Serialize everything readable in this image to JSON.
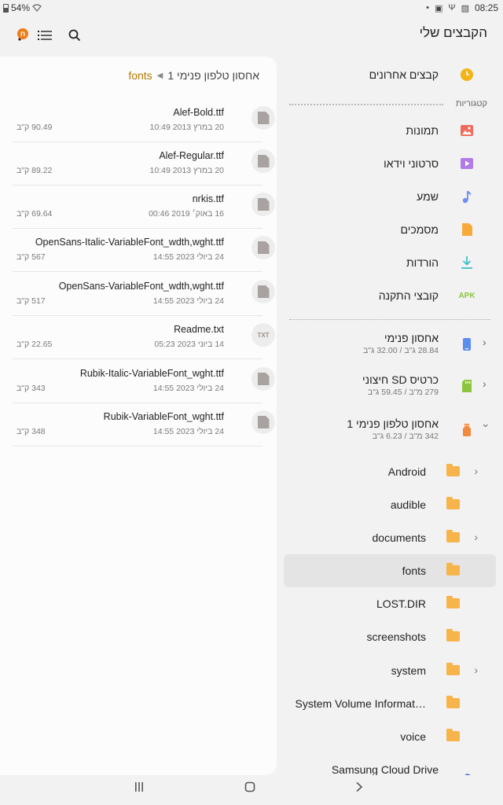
{
  "status": {
    "battery": "54%",
    "time": "08:25"
  },
  "appbar": {
    "title": "הקבצים שלי",
    "badge": "ח"
  },
  "breadcrumb": {
    "root": "אחסון טלפון פנימי 1",
    "current": "fonts"
  },
  "files": [
    {
      "name": "Alef-Bold.ttf",
      "date": "20 במרץ 2013 10:49",
      "size": "90.49 ק\"ב",
      "icon": "font-file-icon"
    },
    {
      "name": "Alef-Regular.ttf",
      "date": "20 במרץ 2013 10:49",
      "size": "89.22 ק\"ב",
      "icon": "font-file-icon"
    },
    {
      "name": "nrkis.ttf",
      "date": "16 באוק׳ 2019 00:46",
      "size": "69.64 ק\"ב",
      "icon": "font-file-icon"
    },
    {
      "name": "OpenSans-Italic-VariableFont_wdth,wght.ttf",
      "date": "24 ביולי 2023 14:55",
      "size": "567 ק\"ב",
      "icon": "font-file-icon"
    },
    {
      "name": "OpenSans-VariableFont_wdth,wght.ttf",
      "date": "24 ביולי 2023 14:55",
      "size": "517 ק\"ב",
      "icon": "font-file-icon"
    },
    {
      "name": "Readme.txt",
      "date": "14 ביוני 2023 05:23",
      "size": "22.65 ק\"ב",
      "icon": "txt-file-icon",
      "icon_text": "TXT"
    },
    {
      "name": "Rubik-Italic-VariableFont_wght.ttf",
      "date": "24 ביולי 2023 14:55",
      "size": "343 ק\"ב",
      "icon": "font-file-icon"
    },
    {
      "name": "Rubik-VariableFont_wght.ttf",
      "date": "24 ביולי 2023 14:55",
      "size": "348 ק\"ב",
      "icon": "font-file-icon"
    }
  ],
  "nav": {
    "recent": "קבצים אחרונים",
    "categories_header": "קטגוריות",
    "categories": [
      {
        "label": "תמונות",
        "icon": "image-icon",
        "color": "#f06b5e"
      },
      {
        "label": "סרטוני וידאו",
        "icon": "video-icon",
        "color": "#b27be8"
      },
      {
        "label": "שמע",
        "icon": "audio-icon",
        "color": "#6b8ef0"
      },
      {
        "label": "מסמכים",
        "icon": "document-icon",
        "color": "#f7a93b"
      },
      {
        "label": "הורדות",
        "icon": "download-icon",
        "color": "#3dbfc9"
      },
      {
        "label": "קובצי התקנה",
        "icon": "apk-icon",
        "color": "#8cc63f",
        "icon_text": "APK"
      }
    ],
    "storage": [
      {
        "label": "אחסון פנימי",
        "sub": "28.84 ג\"ב / 32.00 ג\"ב",
        "icon": "phone-storage-icon",
        "color": "#5b8def"
      },
      {
        "label": "כרטיס SD חיצוני",
        "sub": "279 מ\"ב / 59.45 ג\"ב",
        "icon": "sd-card-icon",
        "color": "#8cc63f"
      },
      {
        "label": "אחסון טלפון פנימי 1",
        "sub": "342 מ\"ב / 6.23 ג\"ב",
        "icon": "usb-storage-icon",
        "color": "#f28a3d"
      }
    ],
    "folders": [
      {
        "label": "Android",
        "chevron": true
      },
      {
        "label": "audible",
        "chevron": false
      },
      {
        "label": "documents",
        "chevron": true
      },
      {
        "label": "fonts",
        "chevron": false,
        "selected": true
      },
      {
        "label": "LOST.DIR",
        "chevron": false
      },
      {
        "label": "screenshots",
        "chevron": false
      },
      {
        "label": "system",
        "chevron": true
      },
      {
        "label": "System Volume Informat…",
        "chevron": false
      },
      {
        "label": "voice",
        "chevron": false
      }
    ],
    "cloud": "Samsung Cloud Drive"
  }
}
